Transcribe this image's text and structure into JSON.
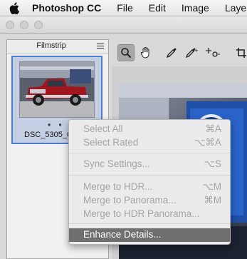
{
  "menubar": {
    "app_name": "Photoshop CC",
    "items": [
      "File",
      "Edit",
      "Image",
      "Layer"
    ]
  },
  "filmstrip": {
    "title": "Filmstrip",
    "thumb_caption": "DSC_5305_C",
    "dots": "• • • • •"
  },
  "context_menu": {
    "items": [
      {
        "label": "Select All",
        "shortcut": "⌘A",
        "enabled": false
      },
      {
        "label": "Select Rated",
        "shortcut": "⌥⌘A",
        "enabled": false
      },
      {
        "label": "Sync Settings...",
        "shortcut": "⌥S",
        "enabled": false
      },
      {
        "label": "Merge to HDR...",
        "shortcut": "⌥M",
        "enabled": false
      },
      {
        "label": "Merge to Panorama...",
        "shortcut": "⌘M",
        "enabled": false
      },
      {
        "label": "Merge to HDR Panorama...",
        "shortcut": "",
        "enabled": false
      },
      {
        "label": "Enhance Details...",
        "shortcut": "",
        "enabled": true,
        "highlighted": true
      }
    ]
  },
  "toolbar": {
    "tools": [
      "zoom-tool",
      "hand-tool",
      "white-balance-tool",
      "color-sampler-tool",
      "targeted-adjustment-tool",
      "crop-tool"
    ],
    "active_tool": "zoom-tool"
  },
  "colors": {
    "selection": "#4a7ed0",
    "menu_highlight": "#6f6f6f"
  }
}
